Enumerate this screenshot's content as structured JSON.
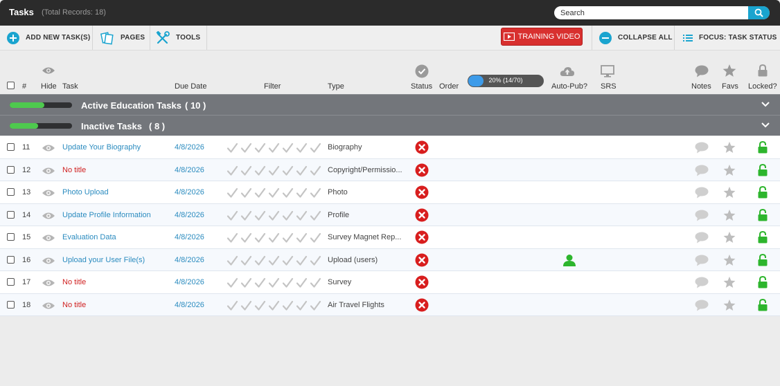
{
  "window": {
    "title": "Tasks",
    "records": "(Total Records: 18)"
  },
  "search": {
    "placeholder": "Search"
  },
  "toolbar": {
    "add": "ADD NEW TASK(S)",
    "pages": "PAGES",
    "tools": "TOOLS",
    "training": "TRAINING VIDEO",
    "collapse": "COLLAPSE ALL",
    "focus": "FOCUS: TASK STATUS"
  },
  "colors": {
    "link": "#2a8bbf",
    "danger": "#d02020",
    "success": "#2db52d",
    "group": "#73767b",
    "accent": "#1aa4cf"
  },
  "columns": {
    "num": "#",
    "hide": "Hide",
    "task": "Task",
    "due": "Due Date",
    "filter": "Filter",
    "type": "Type",
    "status": "Status",
    "order": "Order",
    "autopub": "Auto-Pub?",
    "srs": "SRS",
    "notes": "Notes",
    "favs": "Favs",
    "locked": "Locked?"
  },
  "progress": {
    "label": "20% (14/70)",
    "fraction": 0.2
  },
  "groups": [
    {
      "name": "Active Education Tasks",
      "count": "( 10 )",
      "fraction": 0.55
    },
    {
      "name": "Inactive Tasks",
      "count": "( 8 )",
      "fraction": 0.45
    }
  ],
  "rows": [
    {
      "num": "11",
      "task": "Update Your Biography",
      "untitled": false,
      "due": "4/8/2026",
      "type": "Biography",
      "autopub": false
    },
    {
      "num": "12",
      "task": "No title",
      "untitled": true,
      "due": "4/8/2026",
      "type": "Copyright/Permissio...",
      "autopub": false
    },
    {
      "num": "13",
      "task": "Photo Upload",
      "untitled": false,
      "due": "4/8/2026",
      "type": "Photo",
      "autopub": false
    },
    {
      "num": "14",
      "task": "Update Profile Information",
      "untitled": false,
      "due": "4/8/2026",
      "type": "Profile",
      "autopub": false
    },
    {
      "num": "15",
      "task": "Evaluation Data",
      "untitled": false,
      "due": "4/8/2026",
      "type": "Survey Magnet Rep...",
      "autopub": false
    },
    {
      "num": "16",
      "task": "Upload your User File(s)",
      "untitled": false,
      "due": "4/8/2026",
      "type": "Upload (users)",
      "autopub": true
    },
    {
      "num": "17",
      "task": "No title",
      "untitled": true,
      "due": "4/8/2026",
      "type": "Survey",
      "autopub": false
    },
    {
      "num": "18",
      "task": "No title",
      "untitled": true,
      "due": "4/8/2026",
      "type": "Air Travel Flights",
      "autopub": false
    }
  ]
}
